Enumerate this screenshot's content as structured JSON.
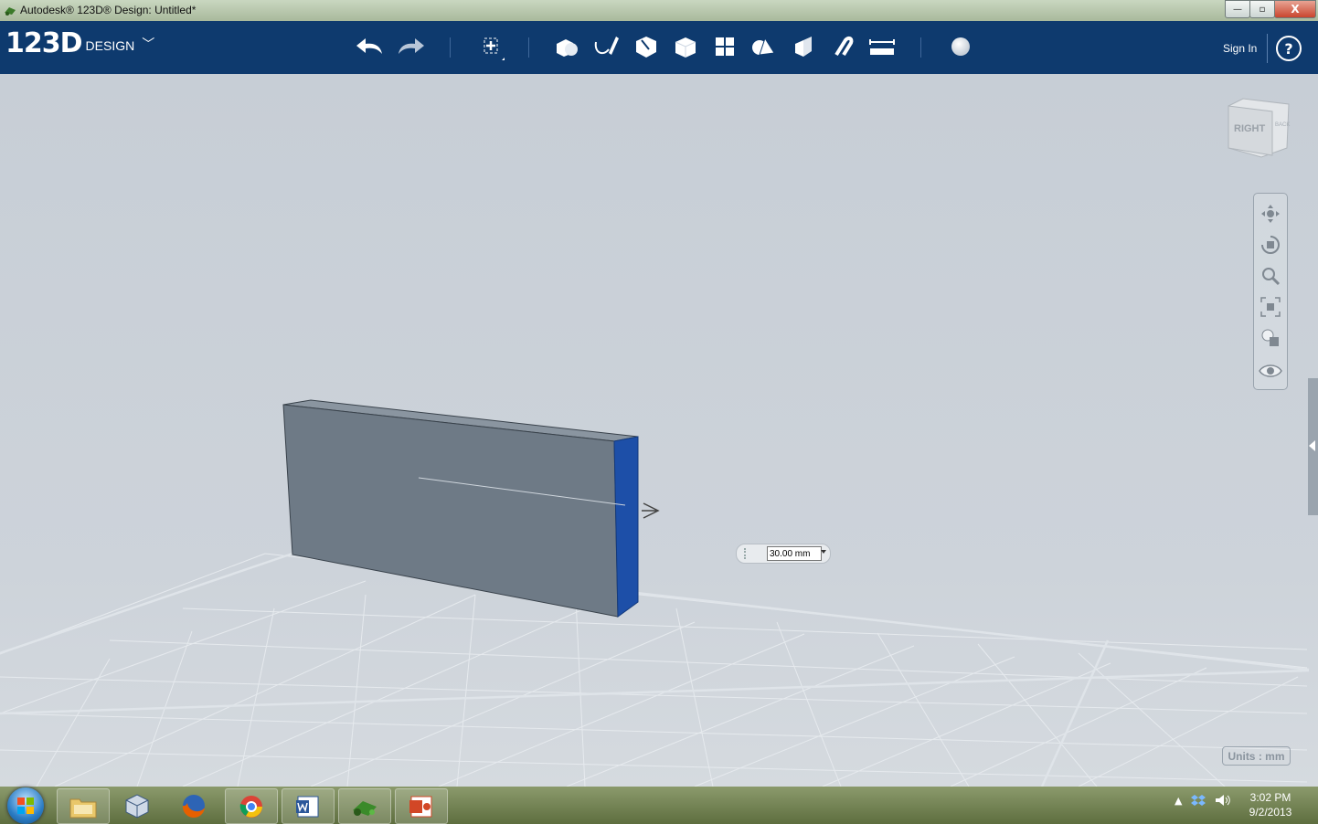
{
  "window": {
    "title": "Autodesk® 123D® Design: Untitled*",
    "minimize": "—",
    "maximize": "▫",
    "close": "X"
  },
  "app": {
    "logo_number": "123D",
    "logo_word": "DESIGN",
    "sign_in": "Sign In",
    "help": "?"
  },
  "viewport": {
    "viewcube_face": "RIGHT",
    "viewcube_side": "BACK",
    "dimension_value": "30.00 mm",
    "units_label": "Units : mm"
  },
  "taskbar": {
    "time": "3:02 PM",
    "date": "9/2/2013"
  },
  "colors": {
    "toolbar": "#0e3a6e",
    "selected_face": "#1d4fa8",
    "box_face": "#6e7a86"
  }
}
